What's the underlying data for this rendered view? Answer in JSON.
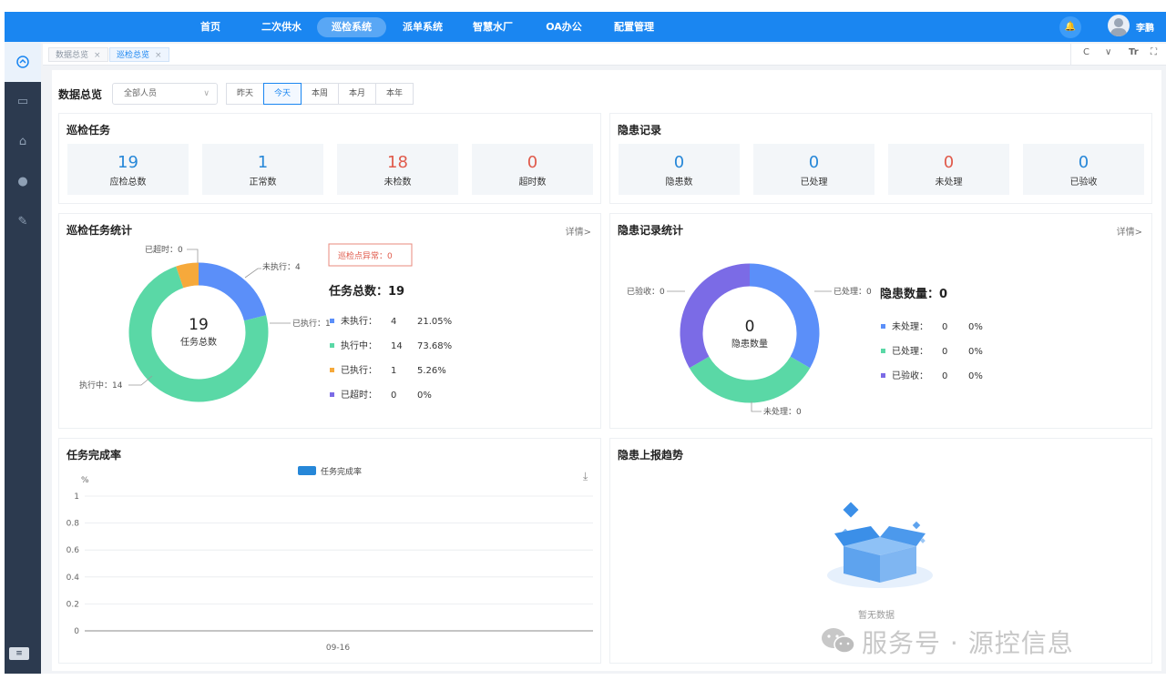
{
  "nav": {
    "items": [
      "首页",
      "二次供水",
      "巡检系统",
      "派单系统",
      "智慧水厂",
      "OA办公",
      "配置管理"
    ],
    "active_index": 2,
    "user_name": "李鹏"
  },
  "tabs": [
    {
      "label": "数据总览",
      "close": "×",
      "active": false
    },
    {
      "label": "巡检总览",
      "close": "×",
      "active": true
    }
  ],
  "toolbar": {
    "refresh": "C",
    "expand": "∨",
    "font": "Tr",
    "fullscreen": "⛶"
  },
  "filter": {
    "title": "数据总览",
    "person_select": "全部人员",
    "ranges": [
      "昨天",
      "今天",
      "本周",
      "本月",
      "本年"
    ],
    "active_range": "今天"
  },
  "inspection_tasks": {
    "title": "巡检任务",
    "stats": [
      {
        "value": "19",
        "label": "应检总数",
        "color": "#2687d8"
      },
      {
        "value": "1",
        "label": "正常数",
        "color": "#2687d8"
      },
      {
        "value": "18",
        "label": "未检数",
        "color": "#e05a4b"
      },
      {
        "value": "0",
        "label": "超时数",
        "color": "#e05a4b"
      }
    ]
  },
  "hazard_records": {
    "title": "隐患记录",
    "stats": [
      {
        "value": "0",
        "label": "隐患数",
        "color": "#2687d8"
      },
      {
        "value": "0",
        "label": "已处理",
        "color": "#2687d8"
      },
      {
        "value": "0",
        "label": "未处理",
        "color": "#e05a4b"
      },
      {
        "value": "0",
        "label": "已验收",
        "color": "#2687d8"
      }
    ]
  },
  "task_stats": {
    "title": "巡检任务统计",
    "more": "详情>",
    "abnormal_badge": "巡检点异常：0",
    "total_label": "任务总数：19",
    "center_value": "19",
    "center_label": "任务总数",
    "legend": [
      {
        "name": "未执行：",
        "count": "4",
        "percent": "21.05%",
        "color": "#5b8ff9"
      },
      {
        "name": "执行中：",
        "count": "14",
        "percent": "73.68%",
        "color": "#5ad8a6"
      },
      {
        "name": "已执行：",
        "count": "1",
        "percent": "5.26%",
        "color": "#f6a93b"
      },
      {
        "name": "已超时：",
        "count": "0",
        "percent": "0%",
        "color": "#7b6be6"
      }
    ],
    "callouts": [
      "已超时：0",
      "未执行：4",
      "已执行：1",
      "执行中：14"
    ]
  },
  "hazard_stats": {
    "title": "隐患记录统计",
    "more": "详情>",
    "total_label": "隐患数量：0",
    "center_value": "0",
    "center_label": "隐患数量",
    "legend": [
      {
        "name": "未处理：",
        "count": "0",
        "percent": "0%",
        "color": "#5b8ff9"
      },
      {
        "name": "已处理：",
        "count": "0",
        "percent": "0%",
        "color": "#5ad8a6"
      },
      {
        "name": "已验收：",
        "count": "0",
        "percent": "0%",
        "color": "#7b6be6"
      }
    ],
    "callouts": [
      "已验收：0",
      "已处理：0",
      "未处理：0"
    ]
  },
  "completion": {
    "title": "任务完成率",
    "legend_label": "任务完成率",
    "download_icon": "⤓"
  },
  "trend": {
    "title": "隐患上报趋势",
    "empty_text": "暂无数据"
  },
  "watermark": {
    "text": "服务号 · 源控信息"
  },
  "chart_data": [
    {
      "type": "pie",
      "title": "巡检任务统计",
      "labels": [
        "未执行",
        "执行中",
        "已执行",
        "已超时"
      ],
      "values": [
        4,
        14,
        1,
        0
      ],
      "colors": [
        "#5b8ff9",
        "#5ad8a6",
        "#f6a93b",
        "#7b6be6"
      ]
    },
    {
      "type": "pie",
      "title": "隐患记录统计",
      "labels": [
        "未处理",
        "已处理",
        "已验收"
      ],
      "values": [
        0,
        0,
        0
      ],
      "colors": [
        "#5b8ff9",
        "#5ad8a6",
        "#7b6be6"
      ],
      "note": "all values zero; ring drawn in three equal parts"
    },
    {
      "type": "line",
      "title": "任务完成率",
      "ylabel": "%",
      "categories": [
        "09-16"
      ],
      "yticks": [
        "1",
        "0.8",
        "0.6",
        "0.4",
        "0.2",
        "0"
      ],
      "ylim": [
        0,
        1
      ],
      "series": [
        {
          "name": "任务完成率",
          "values": []
        }
      ],
      "grid": true,
      "legend": "top-center"
    }
  ]
}
